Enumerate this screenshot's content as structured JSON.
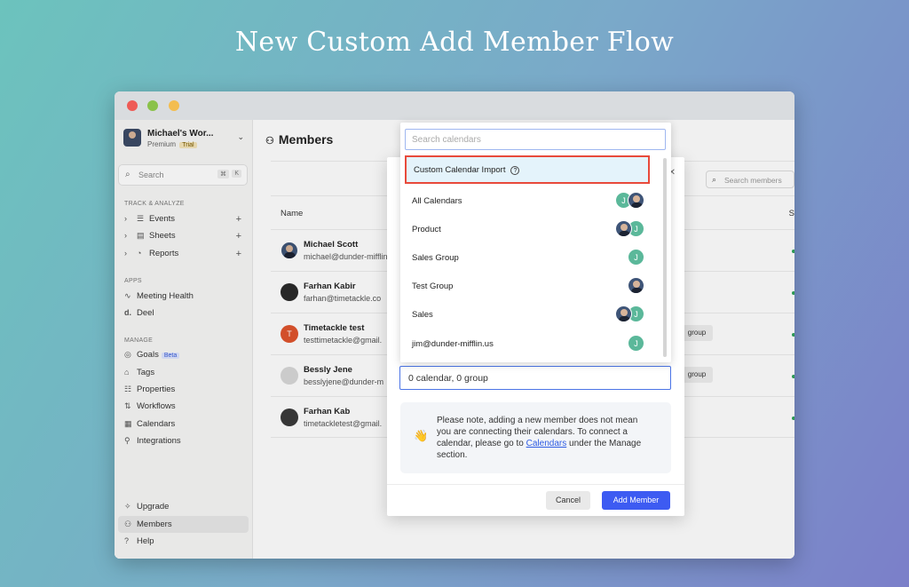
{
  "headline": "New Custom Add Member Flow",
  "sidebar": {
    "workspace": {
      "name": "Michael's Wor...",
      "plan": "Premium",
      "badge": "Trial"
    },
    "search": {
      "placeholder": "Search",
      "kbd1": "⌘",
      "kbd2": "K"
    },
    "track_section": "TRACK & ANALYZE",
    "track_items": [
      {
        "label": "Events"
      },
      {
        "label": "Sheets"
      },
      {
        "label": "Reports"
      }
    ],
    "apps_section": "APPS",
    "apps_items": [
      {
        "label": "Meeting Health"
      },
      {
        "label": "Deel"
      }
    ],
    "manage_section": "MANAGE",
    "manage_items": [
      {
        "label": "Goals",
        "badge": "Beta"
      },
      {
        "label": "Tags"
      },
      {
        "label": "Properties"
      },
      {
        "label": "Workflows"
      },
      {
        "label": "Calendars"
      },
      {
        "label": "Integrations"
      }
    ],
    "bottom_items": [
      {
        "label": "Upgrade"
      },
      {
        "label": "Members"
      },
      {
        "label": "Help"
      }
    ]
  },
  "main": {
    "title": "Members",
    "search_placeholder": "Search members",
    "col_name": "Name",
    "col_status": "S",
    "members": [
      {
        "name": "Michael Scott",
        "email": "michael@dunder-mifflin",
        "group": ""
      },
      {
        "name": "Farhan Kabir",
        "email": "farhan@timetackle.co",
        "group": ""
      },
      {
        "name": "Timetackle test",
        "email": "testtimetackle@gmail.",
        "group": "group",
        "initial": "T"
      },
      {
        "name": "Bessly Jene",
        "email": "besslyjene@dunder-m",
        "group": "group"
      },
      {
        "name": "Farhan Kab",
        "email": "timetackletest@gmail.",
        "group": ""
      }
    ]
  },
  "modal": {
    "selection_summary": "0 calendar, 0 group",
    "note_pre": "Please note, adding a new member does not mean you are connecting their calendars. To connect a calendar, please go to ",
    "note_link": "Calendars",
    "note_post": " under the Manage section.",
    "note_icon": "👋",
    "cancel_label": "Cancel",
    "add_label": "Add Member"
  },
  "dropdown": {
    "search_placeholder": "Search calendars",
    "custom_import_label": "Custom Calendar Import",
    "help_glyph": "?",
    "items": [
      {
        "label": "All Calendars",
        "avatars": [
          "J",
          "photo"
        ]
      },
      {
        "label": "Product",
        "avatars": [
          "photo",
          "J"
        ]
      },
      {
        "label": "Sales Group",
        "avatars": [
          "J"
        ]
      },
      {
        "label": "Test Group",
        "avatars": [
          "photo"
        ]
      },
      {
        "label": "Sales",
        "avatars": [
          "photo",
          "J"
        ]
      },
      {
        "label": "jim@dunder-mifflin.us",
        "avatars": [
          "J"
        ]
      }
    ]
  },
  "colors": {
    "accent": "#3d5bf2",
    "highlight_border": "#e84a3b",
    "highlight_bg": "#e4f3fb",
    "avatar_green": "#5bb89a"
  }
}
